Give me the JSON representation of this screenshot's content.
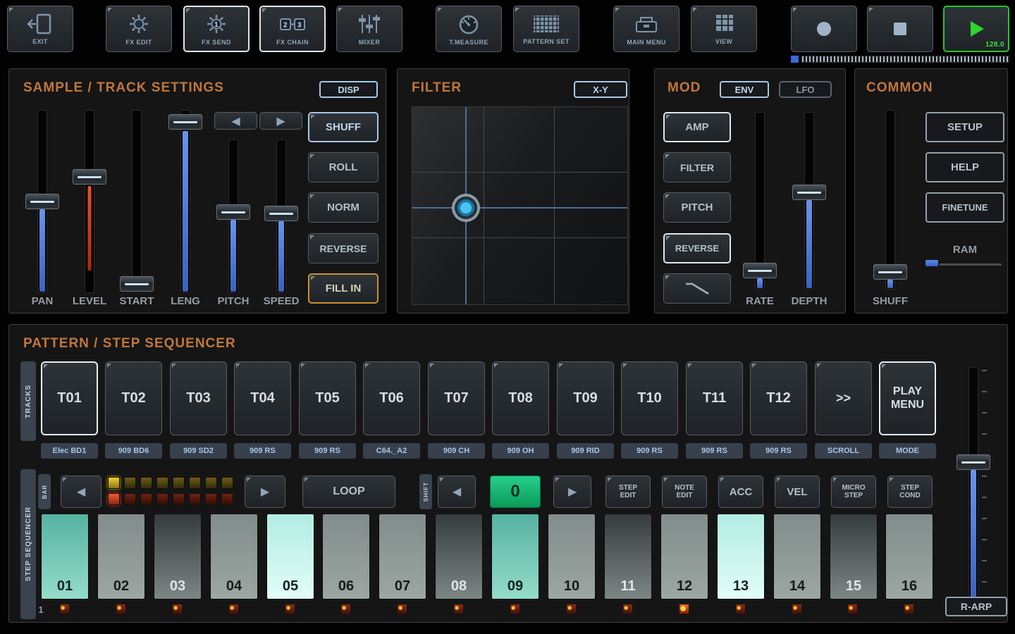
{
  "toolbar": {
    "exit": "EXIT",
    "fx_edit": "FX EDIT",
    "fx_send": "FX SEND",
    "fx_send_num": "1",
    "fx_chain": "FX CHAIN",
    "fx_chain_num1": "2",
    "fx_chain_num2": "3",
    "mixer": "MIXER",
    "t_measure": "T.MEASURE",
    "pattern_set": "PATTERN SET",
    "main_menu": "MAIN MENU",
    "view": "VIEW",
    "bpm": "128.0"
  },
  "sample_track": {
    "title": "SAMPLE / TRACK SETTINGS",
    "disp": "DISP",
    "sliders": [
      "PAN",
      "LEVEL",
      "START",
      "LENG",
      "PITCH",
      "SPEED"
    ],
    "shuff": "SHUFF",
    "roll": "ROLL",
    "norm": "NORM",
    "reverse": "REVERSE",
    "fill_in": "FILL IN"
  },
  "filter": {
    "title": "FILTER",
    "xy": "X-Y"
  },
  "mod": {
    "title": "MOD",
    "env": "ENV",
    "lfo": "LFO",
    "amp": "AMP",
    "filter": "FILTER",
    "pitch": "PITCH",
    "reverse": "REVERSE",
    "rate": "RATE",
    "depth": "DEPTH"
  },
  "common": {
    "title": "COMMON",
    "setup": "SETUP",
    "help": "HELP",
    "finetune": "FINETUNE",
    "ram": "RAM",
    "shuff": "SHUFF"
  },
  "sequencer": {
    "title": "PATTERN / STEP SEQUENCER",
    "tracks_tab": "TRACKS",
    "bar_tab": "BAR",
    "shift_tab": "SHIFT",
    "step_tab": "STEP SEQUENCER",
    "tracks": [
      {
        "id": "T01",
        "sample": "Elec BD1",
        "selected": true
      },
      {
        "id": "T02",
        "sample": "909 BD6",
        "selected": false
      },
      {
        "id": "T03",
        "sample": "909 SD2",
        "selected": false
      },
      {
        "id": "T04",
        "sample": "909 RS",
        "selected": false
      },
      {
        "id": "T05",
        "sample": "909 RS",
        "selected": false
      },
      {
        "id": "T06",
        "sample": "C64._A2",
        "selected": false
      },
      {
        "id": "T07",
        "sample": "909 CH",
        "selected": false
      },
      {
        "id": "T08",
        "sample": "909 OH",
        "selected": false
      },
      {
        "id": "T09",
        "sample": "909 RID",
        "selected": false
      },
      {
        "id": "T10",
        "sample": "909 RS",
        "selected": false
      },
      {
        "id": "T11",
        "sample": "909 RS",
        "selected": false
      },
      {
        "id": "T12",
        "sample": "909 RS",
        "selected": false
      }
    ],
    "scroll_btn": ">>",
    "scroll_lbl": "SCROLL",
    "play_menu": "PLAY MENU",
    "mode_lbl": "MODE",
    "loop": "LOOP",
    "position": "0",
    "step_edit": "STEP EDIT",
    "note_edit": "NOTE EDIT",
    "acc": "ACC",
    "vel": "VEL",
    "micro_step": "MICRO STEP",
    "step_cond": "STEP COND",
    "bar_number": "1",
    "r_arp": "R-ARP",
    "steps": [
      {
        "n": "01",
        "state": "on"
      },
      {
        "n": "02",
        "state": "off"
      },
      {
        "n": "03",
        "state": "dim"
      },
      {
        "n": "04",
        "state": "off"
      },
      {
        "n": "05",
        "state": "hi"
      },
      {
        "n": "06",
        "state": "off"
      },
      {
        "n": "07",
        "state": "off"
      },
      {
        "n": "08",
        "state": "dim"
      },
      {
        "n": "09",
        "state": "on"
      },
      {
        "n": "10",
        "state": "off"
      },
      {
        "n": "11",
        "state": "dim"
      },
      {
        "n": "12",
        "state": "off"
      },
      {
        "n": "13",
        "state": "hi"
      },
      {
        "n": "14",
        "state": "off"
      },
      {
        "n": "15",
        "state": "dim"
      },
      {
        "n": "16",
        "state": "off"
      }
    ]
  },
  "colors": {
    "accent_orange": "#c1773b",
    "accent_blue": "#a7c8e6",
    "play_green": "#2bd42b",
    "display_green": "#19b46f"
  }
}
